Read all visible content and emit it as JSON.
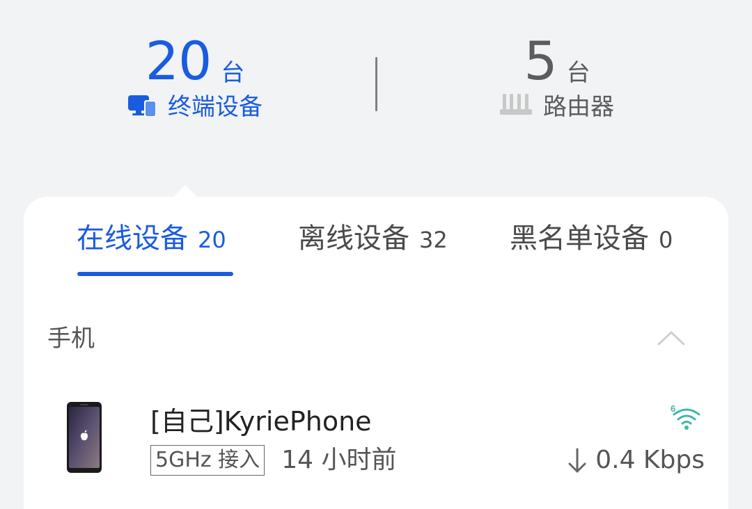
{
  "summary": {
    "terminals": {
      "count": "20",
      "unit": "台",
      "label": "终端设备",
      "icon": "monitor-phone-icon"
    },
    "routers": {
      "count": "5",
      "unit": "台",
      "label": "路由器",
      "icon": "router-icon"
    }
  },
  "tabs": [
    {
      "label": "在线设备",
      "count": "20",
      "active": true
    },
    {
      "label": "离线设备",
      "count": "32",
      "active": false
    },
    {
      "label": "黑名单设备",
      "count": "0",
      "active": false
    }
  ],
  "section": {
    "title": "手机",
    "expanded": true
  },
  "devices": [
    {
      "name": "[自己]KyriePhone",
      "band": "5GHz 接入",
      "last_seen": "14 小时前",
      "speed": "0.4 Kbps",
      "wifi_label": "6",
      "icon": "wifi-6-icon"
    }
  ],
  "colors": {
    "accent": "#1a5ce0",
    "wifi": "#3fb7a8",
    "text_secondary": "#555555"
  }
}
